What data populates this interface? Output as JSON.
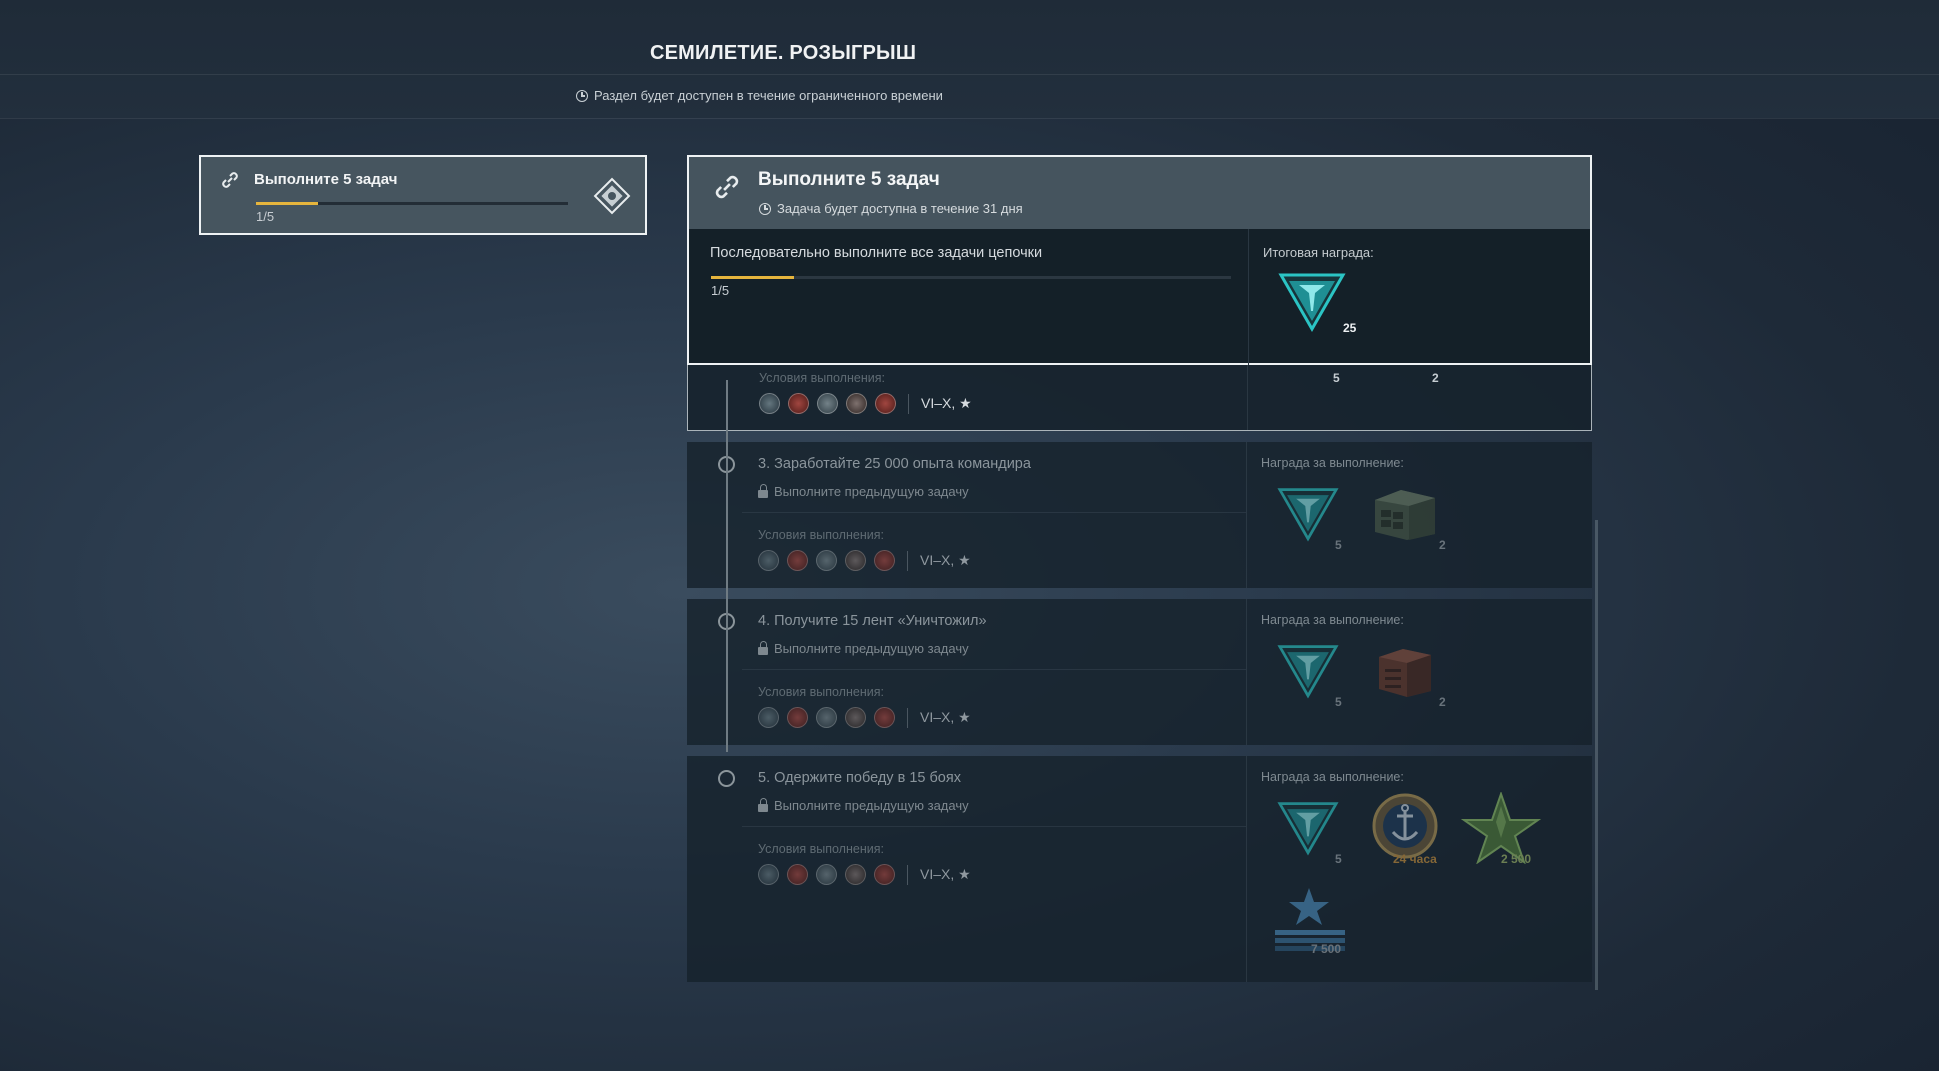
{
  "page": {
    "title": "СЕМИЛЕТИЕ. РОЗЫГРЫШ",
    "subtitle": "Раздел будет доступен в течение ограниченного времени"
  },
  "chain_card": {
    "title": "Выполните 5 задач",
    "progress_text": "1/5",
    "progress": 0.2
  },
  "details": {
    "title": "Выполните 5 задач",
    "subtitle": "Задача будет доступна в течение 31 дня",
    "description": "Последовательно выполните все задачи цепочки",
    "progress_text": "1/5",
    "progress": 0.16,
    "final_reward_label": "Итоговая награда:",
    "final_reward_qty": "25"
  },
  "task2": {
    "cond_label_partial": "Условия выполнения:",
    "tier": "VI–X, ★",
    "reward_qty_1": "5",
    "reward_qty_2": "2"
  },
  "tasks": [
    {
      "title": "3. Заработайте 25 000 опыта командира",
      "lock_text": "Выполните предыдущую задачу",
      "cond_label": "Условия выполнения:",
      "tier": "VI–X, ★",
      "reward_label": "Награда за выполнение:",
      "rewards": [
        {
          "icon": "commemorative-token-icon",
          "qty": "5"
        },
        {
          "icon": "container-icon",
          "qty": "2"
        }
      ]
    },
    {
      "title": "4. Получите 15 лент «Уничтожил»",
      "lock_text": "Выполните предыдущую задачу",
      "cond_label": "Условия выполнения:",
      "tier": "VI–X, ★",
      "reward_label": "Награда за выполнение:",
      "rewards": [
        {
          "icon": "commemorative-token-icon",
          "qty": "5"
        },
        {
          "icon": "supercontainer-icon",
          "qty": "2"
        }
      ]
    },
    {
      "title": "5. Одержите победу в 15 боях",
      "lock_text": "Выполните предыдущую задачу",
      "cond_label": "Условия выполнения:",
      "tier": "VI–X, ★",
      "reward_label": "Награда за выполнение:",
      "rewards": [
        {
          "icon": "commemorative-token-icon",
          "qty": "5"
        },
        {
          "icon": "premium-account-icon",
          "qty": "24 часа"
        },
        {
          "icon": "free-xp-star-icon",
          "qty": "2 500"
        },
        {
          "icon": "commander-xp-icon",
          "qty": "7 500"
        }
      ]
    }
  ],
  "colors": {
    "accent_progress": "#e6b53d",
    "token_teal": "#2bc4c4",
    "panel_header": "#45545e"
  }
}
